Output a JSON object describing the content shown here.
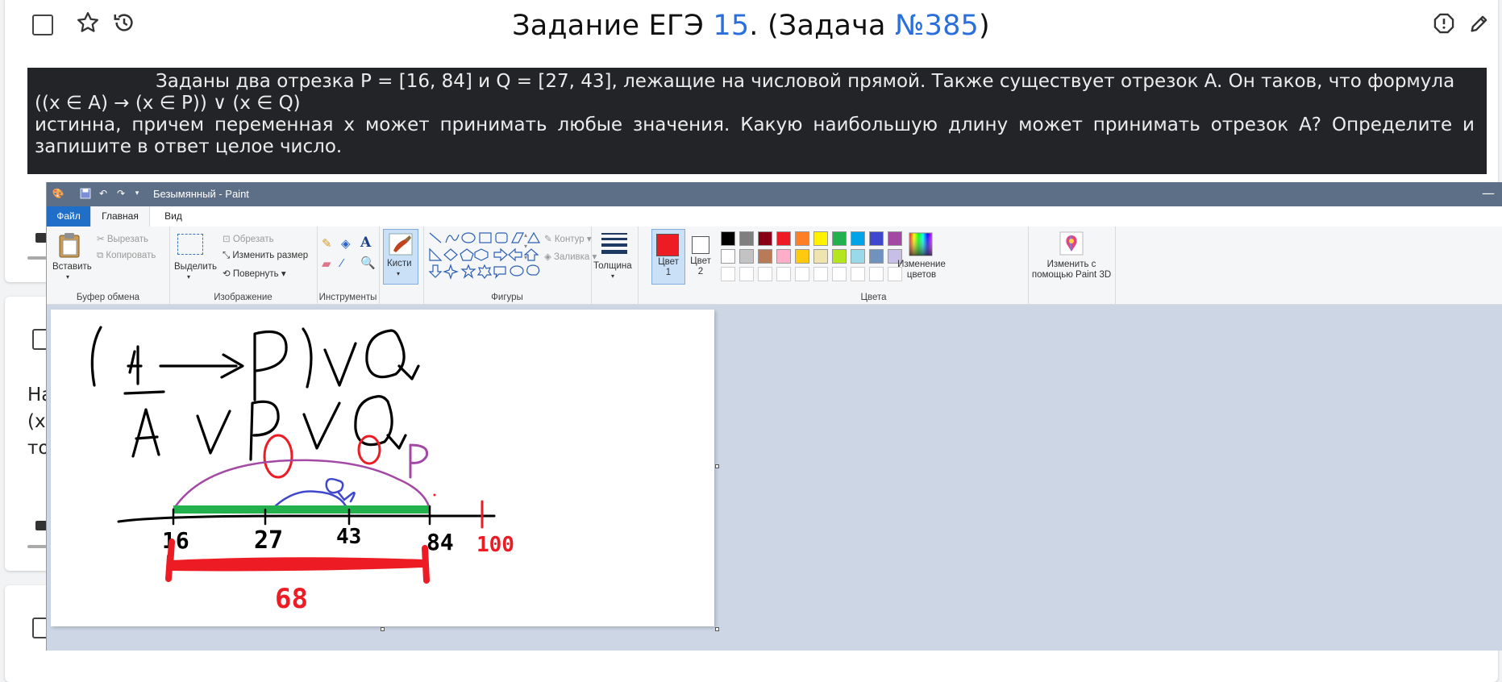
{
  "page": {
    "title_prefix": "Задание ЕГЭ ",
    "title_number": "15",
    "title_middle": ". (Задача ",
    "title_task": "№385",
    "title_suffix": ")",
    "task_line1": "Заданы два отрезка P = [16, 84] и Q = [27, 43], лежащие на числовой прямой. Также существует отрезок A. Он таков, что формула",
    "task_line2": "((x ∈ A) → (x ∈ P)) ∨ (x ∈ Q)",
    "task_line3": "истинна, причем переменная x может принимать любые значения. Какую наибольшую длину может принимать отрезок A? Определите и",
    "task_line4": "запишите в ответ целое число.",
    "card2_peek": [
      "На",
      "(x",
      "то"
    ]
  },
  "paint": {
    "window_title": "Безымянный - Paint",
    "tabs": [
      "Файл",
      "Главная",
      "Вид"
    ],
    "clipboard": {
      "paste": "Вставить",
      "cut": "Вырезать",
      "copy": "Копировать",
      "label": "Буфер обмена"
    },
    "image": {
      "select": "Выделить",
      "crop": "Обрезать",
      "resize": "Изменить размер",
      "rotate": "Повернуть",
      "label": "Изображение"
    },
    "tools": {
      "label": "Инструменты"
    },
    "brushes": "Кисти",
    "shapes": {
      "outline": "Контур",
      "fill": "Заливка",
      "label": "Фигуры"
    },
    "size": "Толщина",
    "color1": "Цвет 1",
    "color2": "Цвет 2",
    "edit_colors": "Изменение цветов",
    "paint3d": "Изменить с помощью Paint 3D",
    "colors_label": "Цвета",
    "palette_row1": [
      "#000000",
      "#7f7f7f",
      "#880015",
      "#ed1c24",
      "#ff7f27",
      "#fff200",
      "#22b14c",
      "#00a2e8",
      "#3f48cc",
      "#a349a4"
    ],
    "palette_row2": [
      "#ffffff",
      "#c3c3c3",
      "#b97a57",
      "#ffaec9",
      "#ffc90e",
      "#efe4b0",
      "#b5e61d",
      "#99d9ea",
      "#7092be",
      "#c8bfe7"
    ],
    "active_color": "#ed1c24"
  },
  "drawing": {
    "formula1": "(A → P) ∨ Q",
    "formula2": "Ā ∨ P ∨ Q",
    "label_p": "P",
    "label_q": "Q",
    "ticks": [
      "16",
      "27",
      "43",
      "84",
      "100"
    ],
    "length": "68",
    "colors": {
      "ink": "#000000",
      "red": "#ed1c24",
      "green": "#22b14c",
      "purple": "#a349a4",
      "blue": "#3f48cc"
    }
  }
}
